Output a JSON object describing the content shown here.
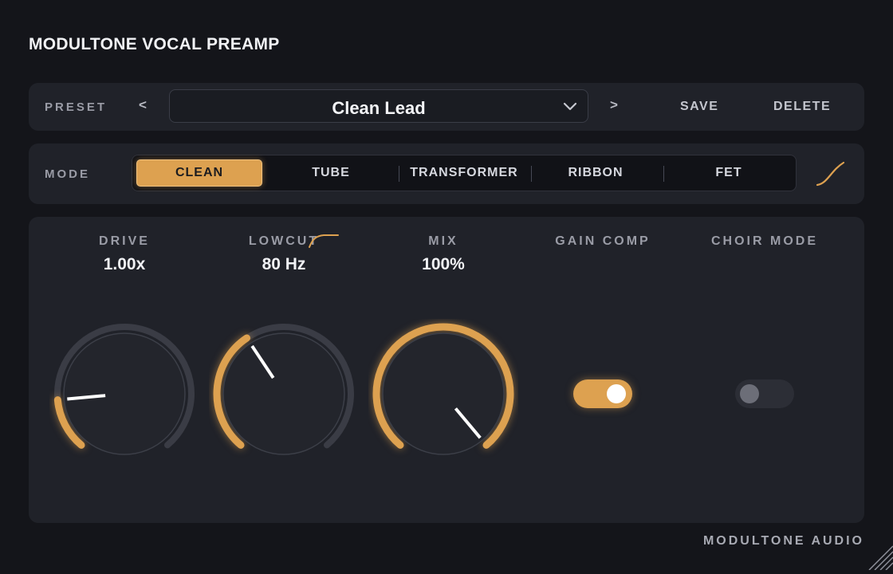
{
  "app": {
    "title": "MODULTONE VOCAL PREAMP",
    "footer_brand": "MODULTONE AUDIO"
  },
  "preset": {
    "label": "PRESET",
    "prev_label": "<",
    "next_label": ">",
    "current": "Clean Lead",
    "save_label": "SAVE",
    "delete_label": "DELETE"
  },
  "mode": {
    "label": "MODE",
    "options": [
      "CLEAN",
      "TUBE",
      "TRANSFORMER",
      "RIBBON",
      "FET"
    ],
    "selected": "CLEAN"
  },
  "controls": {
    "drive": {
      "label": "DRIVE",
      "value": "1.00x",
      "level": 0.16
    },
    "lowcut": {
      "label": "LOWCUT",
      "value": "80 Hz",
      "level": 0.38
    },
    "mix": {
      "label": "MIX",
      "value": "100%",
      "level": 1.0
    },
    "gain_comp": {
      "label": "GAIN COMP",
      "on": true
    },
    "choir_mode": {
      "label": "CHOIR MODE",
      "on": false
    }
  },
  "colors": {
    "accent": "#dda150",
    "background": "#14151a",
    "panel": "#202229",
    "track": "#3a3c45"
  },
  "icons": [
    "chevron-down-icon",
    "curve-icon",
    "highpass-filter-icon",
    "resize-grip-icon"
  ]
}
